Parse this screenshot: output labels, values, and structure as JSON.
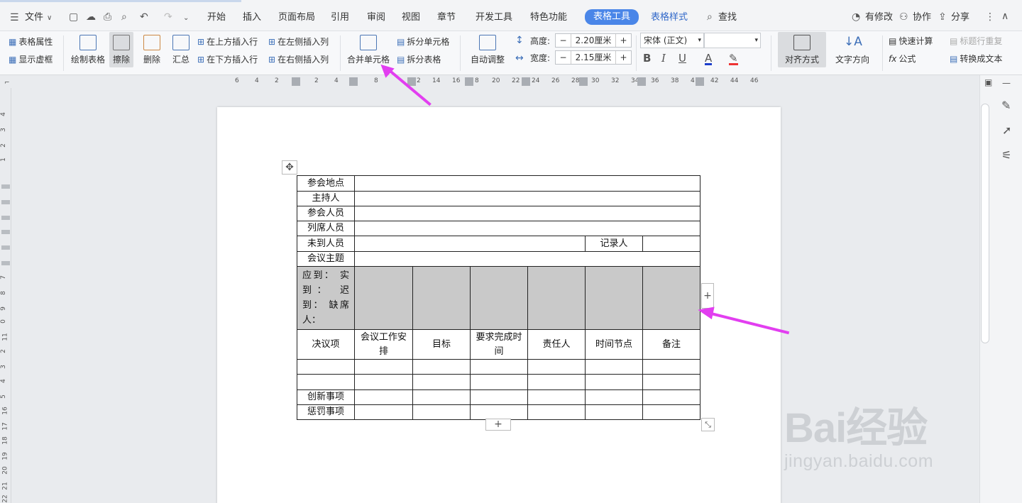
{
  "menubar": {
    "file": "文件",
    "tabs": [
      "开始",
      "插入",
      "页面布局",
      "引用",
      "审阅",
      "视图",
      "章节",
      "开发工具",
      "特色功能"
    ],
    "active_tab": "表格工具",
    "style_tab": "表格样式",
    "search": "查找",
    "changes": "有修改",
    "collab": "协作",
    "share": "分享"
  },
  "ribbon": {
    "table_props": "表格属性",
    "show_grid": "显示虚框",
    "draw_table": "绘制表格",
    "erase": "擦除",
    "delete": "删除",
    "summary": "汇总",
    "insert_above": "在上方插入行",
    "insert_below": "在下方插入行",
    "insert_left": "在左侧插入列",
    "insert_right": "在右侧插入列",
    "merge_cells": "合并单元格",
    "split_cells": "拆分单元格",
    "split_table": "拆分表格",
    "auto_fit": "自动调整",
    "height_label": "高度:",
    "height_value": "2.20厘米",
    "width_label": "宽度:",
    "width_value": "2.15厘米",
    "font": "宋体 (正文)",
    "align": "对齐方式",
    "text_dir": "文字方向",
    "quick_calc": "快速计算",
    "formula": "公式",
    "repeat_header": "标题行重复",
    "convert_text": "转换成文本"
  },
  "ruler": {
    "numbers": [
      "6",
      "4",
      "2",
      "2",
      "4",
      "8",
      "2",
      "14",
      "16",
      "8",
      "20",
      "22",
      "24",
      "26",
      "28",
      "30",
      "32",
      "34",
      "36",
      "38",
      "4",
      "42",
      "44",
      "46"
    ]
  },
  "vruler": {
    "numbers": [
      "4",
      "3",
      "2",
      "1",
      "7",
      "8",
      "9",
      "0",
      "11",
      "2",
      "3",
      "4",
      "5",
      "16",
      "17",
      "18",
      "19",
      "20",
      "21",
      "22"
    ]
  },
  "table": {
    "r1": "参会地点",
    "r2": "主持人",
    "r3": "参会人员",
    "r4": "列席人员",
    "r5": "未到人员",
    "recorder": "记录人",
    "r6": "会议主题",
    "attendance": "应到： 实到： 迟到： 缺席人：",
    "headers": [
      "决议项",
      "会议工作安排",
      "目标",
      "要求完成时间",
      "责任人",
      "时间节点",
      "备注"
    ],
    "innovation": "创新事项",
    "penalty": "惩罚事项"
  },
  "watermark": {
    "brand": "Bai经验",
    "url": "jingyan.baidu.com"
  },
  "colors": {
    "accent": "#4a86e8",
    "arrow": "#e23ef0",
    "shade": "#c9c9c9"
  }
}
